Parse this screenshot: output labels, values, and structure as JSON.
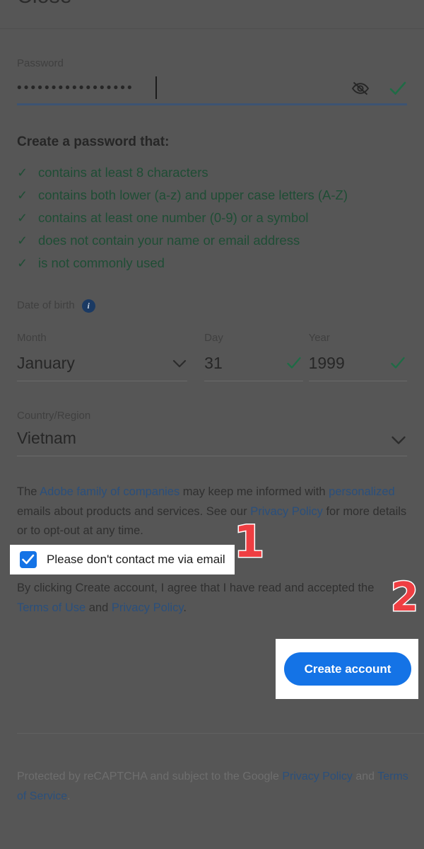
{
  "window": {
    "close_label": "Close",
    "overlay_color": "#565656",
    "accent_blue": "#1473e6",
    "link_blue": "#2a4f7c",
    "valid_green": "#1f4d35",
    "annotation_red": "#ef3e42"
  },
  "password_field": {
    "label": "Password",
    "masked_value": "•••••••••••••••••",
    "eye_icon": "eye-off-icon",
    "valid_icon": "check-icon"
  },
  "password_rules": {
    "title": "Create a password that:",
    "items": [
      {
        "tick": "✓",
        "text": "contains at least 8 characters"
      },
      {
        "tick": "✓",
        "text": "contains both lower (a-z) and upper case letters (A-Z)"
      },
      {
        "tick": "✓",
        "text": "contains at least one number (0-9) or a symbol"
      },
      {
        "tick": "✓",
        "text": "does not contain your name or email address"
      },
      {
        "tick": "✓",
        "text": "is not commonly used"
      }
    ]
  },
  "date_of_birth": {
    "label": "Date of birth",
    "info_icon": "info-icon",
    "info_glyph": "i",
    "month": {
      "label": "Month",
      "value": "January",
      "icon": "chevron-down-icon"
    },
    "day": {
      "label": "Day",
      "value": "31",
      "icon": "check-icon"
    },
    "year": {
      "label": "Year",
      "value": "1999",
      "icon": "check-icon"
    }
  },
  "country": {
    "label": "Country/Region",
    "value": "Vietnam",
    "icon": "chevron-down-icon"
  },
  "consent": {
    "part1": "The ",
    "link1": "Adobe family of companies",
    "part2": " may keep me informed with ",
    "link2": "personalized",
    "part3": " emails about products and services. See our ",
    "link3": "Privacy Policy",
    "part4": " for more details or to opt-out at any time."
  },
  "optout": {
    "checked": true,
    "label": "Please don't contact me via email"
  },
  "terms": {
    "part1": "By clicking Create account, I agree that I have read and accepted the ",
    "link1": "Terms of Use",
    "part2": " and ",
    "link2": "Privacy Policy",
    "part3": "."
  },
  "cta": {
    "label": "Create account"
  },
  "recaptcha": {
    "part1": "Protected by reCAPTCHA and subject to the Google ",
    "link1": "Privacy Policy",
    "part2": " and ",
    "link2": "Terms of Service",
    "part3": "."
  },
  "annotations": [
    {
      "number": "1",
      "target": "optout-checkbox"
    },
    {
      "number": "2",
      "target": "create-account-button"
    }
  ]
}
